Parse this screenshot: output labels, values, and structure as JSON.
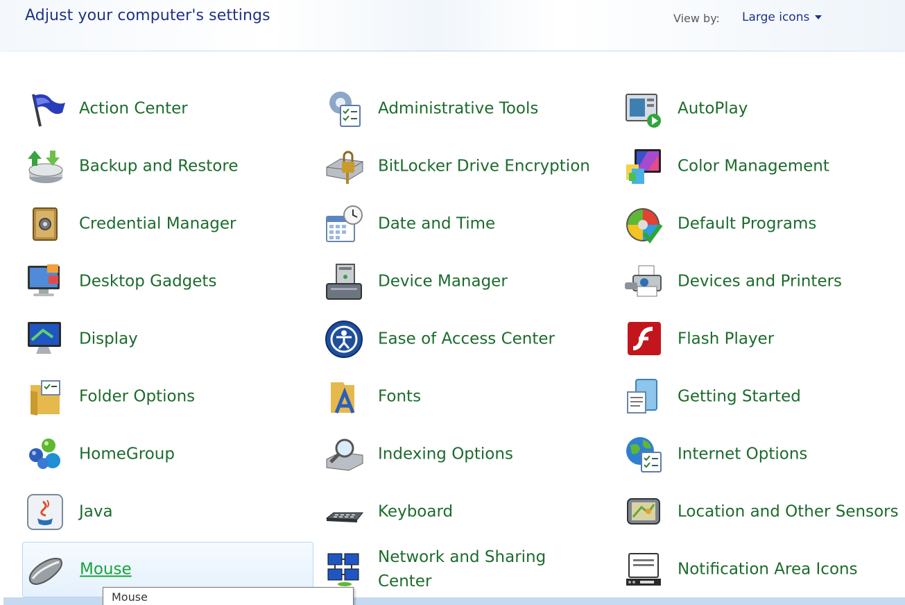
{
  "header": {
    "title": "Adjust your computer's settings",
    "view_by_label": "View by:",
    "view_by_value": "Large icons"
  },
  "items": [
    {
      "label": "Action Center",
      "icon": "flag-icon"
    },
    {
      "label": "Administrative Tools",
      "icon": "admin-tools-icon"
    },
    {
      "label": "AutoPlay",
      "icon": "autoplay-icon"
    },
    {
      "label": "Backup and Restore",
      "icon": "backup-icon"
    },
    {
      "label": "BitLocker Drive Encryption",
      "icon": "bitlocker-icon"
    },
    {
      "label": "Color Management",
      "icon": "color-management-icon"
    },
    {
      "label": "Credential Manager",
      "icon": "credential-vault-icon"
    },
    {
      "label": "Date and Time",
      "icon": "calendar-clock-icon"
    },
    {
      "label": "Default Programs",
      "icon": "default-programs-icon"
    },
    {
      "label": "Desktop Gadgets",
      "icon": "gadgets-icon"
    },
    {
      "label": "Device Manager",
      "icon": "device-manager-icon"
    },
    {
      "label": "Devices and Printers",
      "icon": "printer-icon"
    },
    {
      "label": "Display",
      "icon": "display-icon"
    },
    {
      "label": "Ease of Access Center",
      "icon": "ease-of-access-icon"
    },
    {
      "label": "Flash Player",
      "icon": "flash-icon"
    },
    {
      "label": "Folder Options",
      "icon": "folder-icon"
    },
    {
      "label": "Fonts",
      "icon": "fonts-icon"
    },
    {
      "label": "Getting Started",
      "icon": "getting-started-icon"
    },
    {
      "label": "HomeGroup",
      "icon": "homegroup-icon"
    },
    {
      "label": "Indexing Options",
      "icon": "indexing-icon"
    },
    {
      "label": "Internet Options",
      "icon": "internet-options-icon"
    },
    {
      "label": "Java",
      "icon": "java-icon"
    },
    {
      "label": "Keyboard",
      "icon": "keyboard-icon"
    },
    {
      "label": "Location and Other Sensors",
      "icon": "location-sensor-icon"
    },
    {
      "label": "Mouse",
      "icon": "mouse-icon"
    },
    {
      "label": "Network and Sharing Center",
      "icon": "network-icon"
    },
    {
      "label": "Notification Area Icons",
      "icon": "notification-area-icon"
    }
  ],
  "tooltip": {
    "text": "Mouse"
  },
  "colors": {
    "title": "#1e3287",
    "link": "#1c6b2c",
    "hover_link": "#19a33a",
    "hover_bg": "#e5f1fc"
  }
}
